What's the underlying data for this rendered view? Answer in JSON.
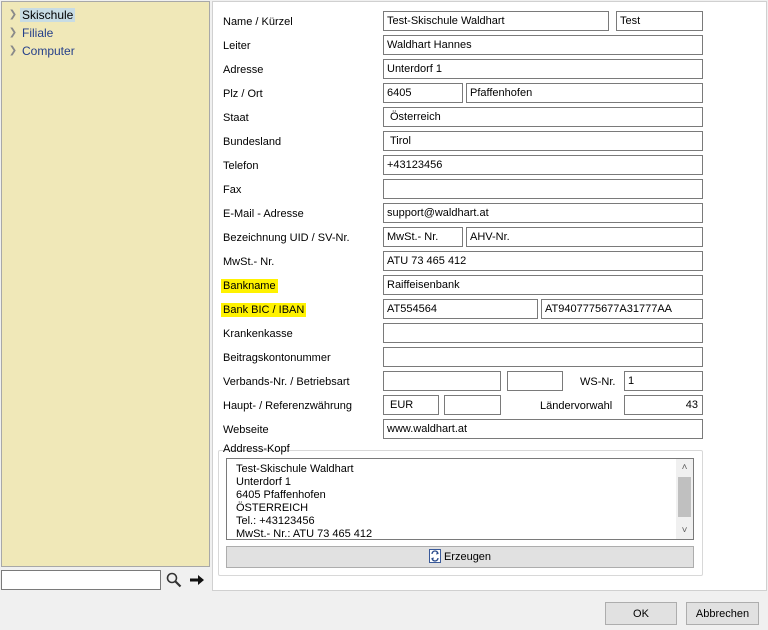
{
  "tree": {
    "items": [
      {
        "label": "Skischule",
        "selected": true
      },
      {
        "label": "Filiale",
        "selected": false
      },
      {
        "label": "Computer",
        "selected": false
      }
    ],
    "search_value": ""
  },
  "form": {
    "labels": {
      "name": "Name / Kürzel",
      "leiter": "Leiter",
      "adresse": "Adresse",
      "plz_ort": "Plz / Ort",
      "staat": "Staat",
      "bundesland": "Bundesland",
      "telefon": "Telefon",
      "fax": "Fax",
      "email": "E-Mail - Adresse",
      "uid_sv": "Bezeichnung UID / SV-Nr.",
      "mwst": "MwSt.- Nr.",
      "bankname": "Bankname",
      "bic_iban": "Bank BIC / IBAN",
      "krankenkasse": "Krankenkasse",
      "beitragskonto": "Beitragskontonummer",
      "verbands": "Verbands-Nr. / Betriebsart",
      "ws_nr": "WS-Nr.",
      "waehrung": "Haupt- / Referenzwährung",
      "laendervorwahl": "Ländervorwahl",
      "webseite": "Webseite"
    },
    "values": {
      "name": "Test-Skischule Waldhart",
      "kuerzel": "Test",
      "leiter": "Waldhart Hannes",
      "adresse": "Unterdorf 1",
      "plz": "6405",
      "ort": "Pfaffenhofen",
      "staat": "Österreich",
      "bundesland": "Tirol",
      "telefon": "+43123456",
      "fax": "",
      "email": "support@waldhart.at",
      "uid_bez": "MwSt.- Nr.",
      "sv_bez": "AHV-Nr.",
      "mwst": "ATU 73 465 412",
      "bankname": "Raiffeisenbank",
      "bic": "AT554564",
      "iban": "AT9407775677A31777AA",
      "krankenkasse": "",
      "beitragskonto": "",
      "verbands_nr": "",
      "betriebsart": "",
      "ws_nr": "1",
      "hauptwaehrung": "EUR",
      "referenzwaehrung": "",
      "laendervorwahl": "43",
      "webseite": "www.waldhart.at"
    }
  },
  "address_head": {
    "title": "Address-Kopf",
    "lines": [
      "Test-Skischule Waldhart",
      "Unterdorf 1",
      "6405 Pfaffenhofen",
      "ÖSTERREICH",
      "Tel.: +43123456",
      "MwSt.- Nr.: ATU 73 465 412"
    ],
    "generate_label": "Erzeugen"
  },
  "dialog": {
    "ok_label": "OK",
    "cancel_label": "Abbrechen"
  },
  "colors": {
    "tree_background": "#f0e8b8",
    "highlight": "#fff200",
    "tree_text": "#243f8a"
  }
}
